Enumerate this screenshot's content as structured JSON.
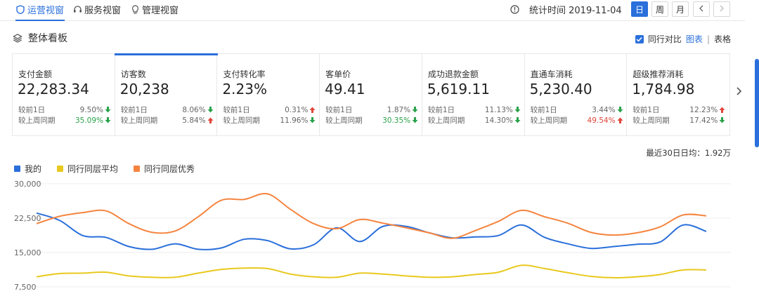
{
  "nav": {
    "tabs": [
      {
        "label": "运营视窗",
        "icon": "shield-icon",
        "active": true
      },
      {
        "label": "服务视窗",
        "icon": "headset-icon",
        "active": false
      },
      {
        "label": "管理视窗",
        "icon": "bulb-icon",
        "active": false
      }
    ],
    "stat_time": "统计时间 2019-11-04",
    "info_icon": "info-icon",
    "period_buttons": [
      "日",
      "周",
      "月"
    ],
    "prev_icon": "chevron-left-icon",
    "next_icon": "chevron-right-icon"
  },
  "panel": {
    "title": "整体看板",
    "icon": "layers-icon",
    "compare_label": "同行对比",
    "view_chart": "图表",
    "separator": "|",
    "view_table": "表格"
  },
  "cards": [
    {
      "name": "支付金额",
      "value": "22,283.34",
      "d_label": "较前1日",
      "d_val": "9.50%",
      "d_dir": "down",
      "w_label": "较上周同期",
      "w_val": "35.09%",
      "w_dir": "down"
    },
    {
      "name": "访客数",
      "value": "20,238",
      "d_label": "较前1日",
      "d_val": "8.06%",
      "d_dir": "down",
      "w_label": "较上周同期",
      "w_val": "5.84%",
      "w_dir": "up"
    },
    {
      "name": "支付转化率",
      "value": "2.23%",
      "d_label": "较前1日",
      "d_val": "0.31%",
      "d_dir": "up",
      "w_label": "较上周同期",
      "w_val": "11.96%",
      "w_dir": "down"
    },
    {
      "name": "客单价",
      "value": "49.41",
      "d_label": "较前1日",
      "d_val": "1.87%",
      "d_dir": "down",
      "w_label": "较上周同期",
      "w_val": "30.35%",
      "w_dir": "down"
    },
    {
      "name": "成功退款金额",
      "value": "5,619.11",
      "d_label": "较前1日",
      "d_val": "11.13%",
      "d_dir": "down",
      "w_label": "较上周同期",
      "w_val": "14.30%",
      "w_dir": "down"
    },
    {
      "name": "直通车消耗",
      "value": "5,230.40",
      "d_label": "较前1日",
      "d_val": "3.44%",
      "d_dir": "down",
      "w_label": "较上周同期",
      "w_val": "49.54%",
      "w_dir": "up"
    },
    {
      "name": "超级推荐消耗",
      "value": "1,784.98",
      "d_label": "较前1日",
      "d_val": "12.23%",
      "d_dir": "up",
      "w_label": "较上周同期",
      "w_val": "17.42%",
      "w_dir": "down"
    }
  ],
  "colors": {
    "accent": "#2a6fdb",
    "up": "#e0453a",
    "down": "#2aa24a"
  },
  "avg_label": "最近30日日均：1.92万",
  "chart_data": {
    "type": "line",
    "ylim": [
      7500,
      30000
    ],
    "yticks": [
      "30,000",
      "22,500",
      "15,000",
      "7,500"
    ],
    "ytick_values": [
      30000,
      22500,
      15000,
      7500
    ],
    "series": [
      {
        "name": "我的",
        "color": "#2a6fdb",
        "values": [
          23600,
          22000,
          18700,
          18300,
          16300,
          15700,
          16900,
          15700,
          16000,
          17900,
          17600,
          15800,
          16700,
          20400,
          17400,
          20700,
          20700,
          19300,
          18200,
          18400,
          18700,
          21000,
          18300,
          16900,
          15900,
          16300,
          16800,
          17300,
          21000,
          19600
        ]
      },
      {
        "name": "同行同层平均",
        "color": "#e8c91e",
        "values": [
          9700,
          10400,
          10500,
          10700,
          9900,
          9600,
          9600,
          10500,
          11300,
          11600,
          11500,
          10300,
          9700,
          9600,
          10500,
          10300,
          9900,
          9600,
          9700,
          10200,
          10700,
          12200,
          11500,
          10600,
          9800,
          9500,
          9700,
          10200,
          11200,
          11200
        ]
      },
      {
        "name": "同行同层优秀",
        "color": "#f5843f",
        "values": [
          21300,
          22900,
          23700,
          24100,
          21300,
          19400,
          19700,
          22800,
          26400,
          26600,
          27800,
          24400,
          21300,
          20200,
          22200,
          21400,
          20400,
          19300,
          18100,
          19800,
          21800,
          24200,
          22800,
          21400,
          19400,
          18800,
          19300,
          20600,
          23200,
          23000
        ]
      }
    ]
  }
}
